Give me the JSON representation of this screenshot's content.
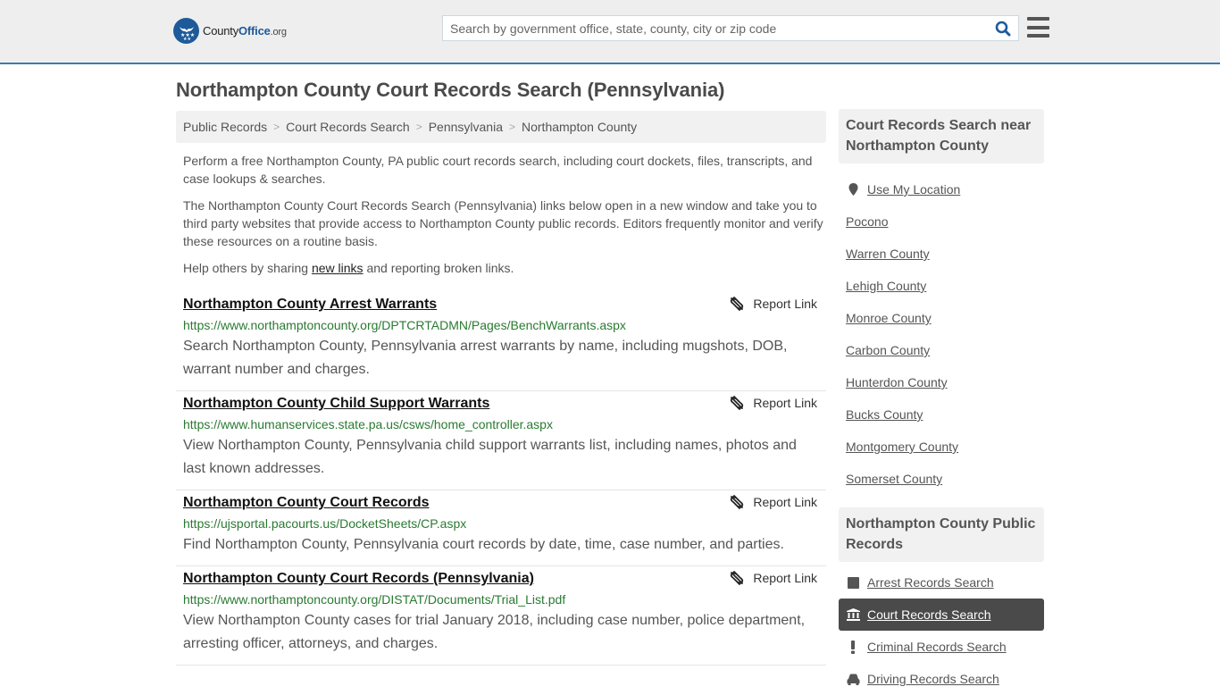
{
  "header": {
    "logo": {
      "name_part1": "County",
      "name_part2": "Office",
      "suffix": ".org"
    },
    "search": {
      "placeholder": "Search by government office, state, county, city or zip code",
      "value": ""
    },
    "colors": {
      "brand": "#1d5a9a",
      "header_border": "#3a7bb0"
    }
  },
  "page": {
    "title": "Northampton County Court Records Search (Pennsylvania)"
  },
  "breadcrumb": [
    {
      "label": "Public Records"
    },
    {
      "label": "Court Records Search"
    },
    {
      "label": "Pennsylvania"
    },
    {
      "label": "Northampton County"
    }
  ],
  "intro": {
    "p1": "Perform a free Northampton County, PA public court records search, including court dockets, files, transcripts, and case lookups & searches.",
    "p2": "The Northampton County Court Records Search (Pennsylvania) links below open in a new window and take you to third party websites that provide access to Northampton County public records. Editors frequently monitor and verify these resources on a routine basis.",
    "p3_before": "Help others by sharing ",
    "p3_link": "new links",
    "p3_after": " and reporting broken links."
  },
  "results": [
    {
      "title": "Northampton County Arrest Warrants",
      "url": "https://www.northamptoncounty.org/DPTCRTADMN/Pages/BenchWarrants.aspx",
      "description": "Search Northampton County, Pennsylvania arrest warrants by name, including mugshots, DOB, warrant number and charges.",
      "report_label": "Report Link"
    },
    {
      "title": "Northampton County Child Support Warrants",
      "url": "https://www.humanservices.state.pa.us/csws/home_controller.aspx",
      "description": "View Northampton County, Pennsylvania child support warrants list, including names, photos and last known addresses.",
      "report_label": "Report Link"
    },
    {
      "title": "Northampton County Court Records",
      "url": "https://ujsportal.pacourts.us/DocketSheets/CP.aspx",
      "description": "Find Northampton County, Pennsylvania court records by date, time, case number, and parties.",
      "report_label": "Report Link"
    },
    {
      "title": "Northampton County Court Records (Pennsylvania)",
      "url": "https://www.northamptoncounty.org/DISTAT/Documents/Trial_List.pdf",
      "description": "View Northampton County cases for trial January 2018, including case number, police department, arresting officer, attorneys, and charges.",
      "report_label": "Report Link"
    }
  ],
  "sidebar": {
    "nearby": {
      "heading": "Court Records Search near Northampton County",
      "use_location": "Use My Location",
      "items": [
        {
          "label": "Pocono"
        },
        {
          "label": "Warren County"
        },
        {
          "label": "Lehigh County"
        },
        {
          "label": "Monroe County"
        },
        {
          "label": "Carbon County"
        },
        {
          "label": "Hunterdon County"
        },
        {
          "label": "Bucks County"
        },
        {
          "label": "Montgomery County"
        },
        {
          "label": "Somerset County"
        }
      ]
    },
    "public_records": {
      "heading": "Northampton County Public Records",
      "items": [
        {
          "label": "Arrest Records Search",
          "icon": "square-icon",
          "active": false
        },
        {
          "label": "Court Records Search",
          "icon": "courthouse-icon",
          "active": true
        },
        {
          "label": "Criminal Records Search",
          "icon": "exclamation-icon",
          "active": false
        },
        {
          "label": "Driving Records Search",
          "icon": "car-icon",
          "active": false
        }
      ]
    }
  }
}
